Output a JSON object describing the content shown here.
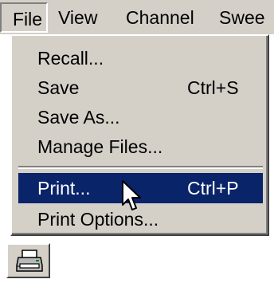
{
  "menubar": {
    "items": [
      {
        "label": "File",
        "active": true
      },
      {
        "label": "View"
      },
      {
        "label": "Channel"
      },
      {
        "label": "Swee"
      }
    ]
  },
  "file_menu": {
    "items": [
      {
        "label": "Recall...",
        "shortcut": ""
      },
      {
        "label": "Save",
        "shortcut": "Ctrl+S"
      },
      {
        "label": "Save As...",
        "shortcut": ""
      },
      {
        "label": "Manage Files...",
        "shortcut": ""
      },
      {
        "label": "Print...",
        "shortcut": "Ctrl+P",
        "highlighted": true
      },
      {
        "label": "Print Options...",
        "shortcut": ""
      }
    ]
  },
  "toolbar": {
    "print_icon": "printer-icon"
  },
  "colors": {
    "menu_bg": "#d4d0c8",
    "highlight_bg": "#0a246a",
    "highlight_fg": "#ffffff"
  }
}
